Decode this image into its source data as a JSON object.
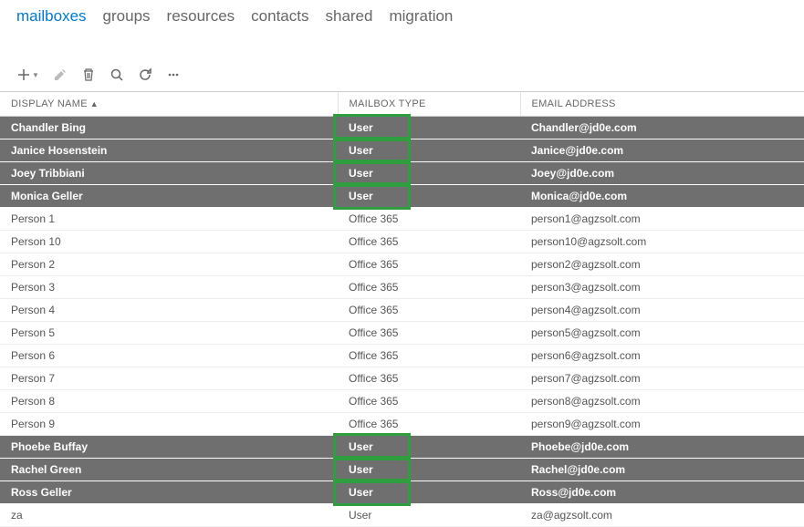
{
  "tabs": [
    "mailboxes",
    "groups",
    "resources",
    "contacts",
    "shared",
    "migration"
  ],
  "activeTab": 0,
  "columns": {
    "name": "DISPLAY NAME",
    "type": "MAILBOX TYPE",
    "email": "EMAIL ADDRESS"
  },
  "rows": [
    {
      "name": "Chandler Bing",
      "type": "User",
      "email": "Chandler@jd0e.com",
      "sel": true,
      "hl": true
    },
    {
      "name": "Janice Hosenstein",
      "type": "User",
      "email": "Janice@jd0e.com",
      "sel": true,
      "hl": true
    },
    {
      "name": "Joey Tribbiani",
      "type": "User",
      "email": "Joey@jd0e.com",
      "sel": true,
      "hl": true
    },
    {
      "name": "Monica Geller",
      "type": "User",
      "email": "Monica@jd0e.com",
      "sel": true,
      "hl": true
    },
    {
      "name": "Person 1",
      "type": "Office 365",
      "email": "person1@agzsolt.com",
      "sel": false,
      "hl": false
    },
    {
      "name": "Person 10",
      "type": "Office 365",
      "email": "person10@agzsolt.com",
      "sel": false,
      "hl": false
    },
    {
      "name": "Person 2",
      "type": "Office 365",
      "email": "person2@agzsolt.com",
      "sel": false,
      "hl": false
    },
    {
      "name": "Person 3",
      "type": "Office 365",
      "email": "person3@agzsolt.com",
      "sel": false,
      "hl": false
    },
    {
      "name": "Person 4",
      "type": "Office 365",
      "email": "person4@agzsolt.com",
      "sel": false,
      "hl": false
    },
    {
      "name": "Person 5",
      "type": "Office 365",
      "email": "person5@agzsolt.com",
      "sel": false,
      "hl": false
    },
    {
      "name": "Person 6",
      "type": "Office 365",
      "email": "person6@agzsolt.com",
      "sel": false,
      "hl": false
    },
    {
      "name": "Person 7",
      "type": "Office 365",
      "email": "person7@agzsolt.com",
      "sel": false,
      "hl": false
    },
    {
      "name": "Person 8",
      "type": "Office 365",
      "email": "person8@agzsolt.com",
      "sel": false,
      "hl": false
    },
    {
      "name": "Person 9",
      "type": "Office 365",
      "email": "person9@agzsolt.com",
      "sel": false,
      "hl": false
    },
    {
      "name": "Phoebe Buffay",
      "type": "User",
      "email": "Phoebe@jd0e.com",
      "sel": true,
      "hl": true
    },
    {
      "name": "Rachel Green",
      "type": "User",
      "email": "Rachel@jd0e.com",
      "sel": true,
      "hl": true
    },
    {
      "name": "Ross Geller",
      "type": "User",
      "email": "Ross@jd0e.com",
      "sel": true,
      "hl": true
    },
    {
      "name": "za",
      "type": "User",
      "email": "za@agzsolt.com",
      "sel": false,
      "hl": false
    }
  ]
}
